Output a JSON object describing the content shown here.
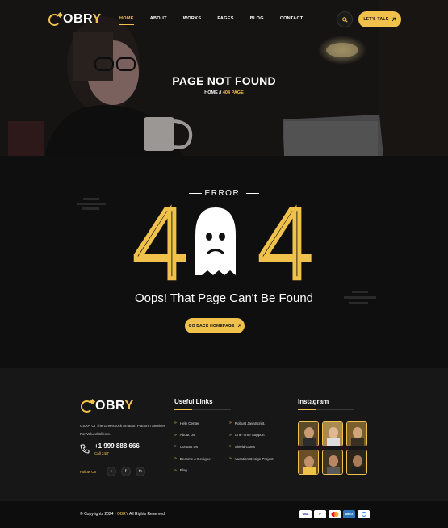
{
  "nav": {
    "brand_prefix": "OBR",
    "brand_suffix": "Y",
    "items": [
      {
        "label": "HOME",
        "active": true
      },
      {
        "label": "ABOUT",
        "active": false
      },
      {
        "label": "WORKS",
        "active": false
      },
      {
        "label": "PAGES",
        "active": false
      },
      {
        "label": "BLOG",
        "active": false
      },
      {
        "label": "CONTACT",
        "active": false
      }
    ],
    "cta_label": "LET'S TALK",
    "cta_icon": "arrow-up-right-icon",
    "search_icon": "search-icon"
  },
  "hero": {
    "title": "PAGE NOT FOUND",
    "crumb_home": "HOME",
    "crumb_sep": "//",
    "crumb_current": "404 PAGE"
  },
  "error": {
    "label": "ERROR.",
    "digit_left": "4",
    "digit_right": "4",
    "message": "Oops! That Page Can't Be Found",
    "button_label": "GO BACK HOMEPAGE",
    "button_icon": "arrow-up-right-icon"
  },
  "footer": {
    "brand_prefix": "OBR",
    "brand_suffix": "Y",
    "description": "GSAP, Or The GreenSock Amation Platform Services For Valued Clients.",
    "phone": "+1 999 888 666",
    "phone_sub": "Call 24/7",
    "follow_label": "Follow On :",
    "socials": [
      "twitter-icon",
      "facebook-icon",
      "linkedin-icon"
    ],
    "useful_links_title": "Useful Links",
    "links_left": [
      "Help Center",
      "About Us",
      "Contact Us",
      "Become A Designer",
      "Blog"
    ],
    "links_right": [
      "Robust JavaScript.",
      "One-Time Support",
      "Shield Glass",
      "Vacation Design Project"
    ],
    "instagram_title": "Instagram",
    "copyright_prefix": "© Copyrights 2024 - ",
    "copyright_brand": "OBRY",
    "copyright_suffix": " All Rights Reserved.",
    "payments": [
      "VISA",
      "PayPal",
      "MC",
      "AMEX",
      "Other"
    ]
  },
  "colors": {
    "accent": "#f0c24b",
    "background": "#0f0f0f",
    "footer": "#171717"
  }
}
